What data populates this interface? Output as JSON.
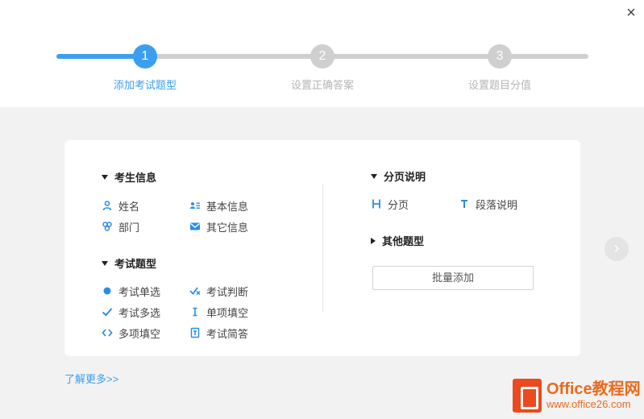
{
  "close_label": "×",
  "steps": [
    {
      "num": "1",
      "label": "添加考试题型"
    },
    {
      "num": "2",
      "label": "设置正确答案"
    },
    {
      "num": "3",
      "label": "设置题目分值"
    }
  ],
  "sections": {
    "candidate_info": {
      "title": "考生信息",
      "items": {
        "name": "姓名",
        "basic_info": "基本信息",
        "department": "部门",
        "other_info": "其它信息"
      }
    },
    "exam_types": {
      "title": "考试题型",
      "items": {
        "single_choice": "考试单选",
        "judgment": "考试判断",
        "multi_choice": "考试多选",
        "single_fill": "单项填空",
        "multi_fill": "多项填空",
        "short_answer": "考试简答"
      }
    },
    "page_desc": {
      "title": "分页说明",
      "items": {
        "page_break": "分页",
        "paragraph": "段落说明"
      }
    },
    "other_types": {
      "title": "其他题型"
    }
  },
  "batch_add_label": "批量添加",
  "learn_more_label": "了解更多>>",
  "next_arrow_label": "›",
  "watermark": {
    "line1": "Office教程网",
    "line2": "www.office26.com"
  },
  "colors": {
    "accent": "#3a9ff0",
    "inactive": "#cfcfcf",
    "watermark": "#ea4a1e"
  }
}
